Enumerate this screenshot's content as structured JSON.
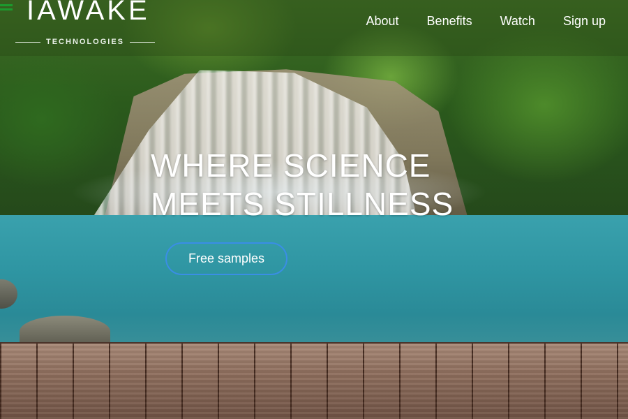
{
  "brand": {
    "name": "IAWAKE",
    "subtitle": "TECHNOLOGIES"
  },
  "nav": {
    "menu_icon": "hamburger-menu-icon",
    "links": [
      "About",
      "Benefits",
      "Watch",
      "Sign up"
    ]
  },
  "hero": {
    "title_lines": [
      "WHERE SCIENCE",
      "MEETS STILLNESS"
    ],
    "cta_label": "Free samples"
  },
  "colors": {
    "accent_menu": "#1c9a2e",
    "cta_border": "#3a8ee6",
    "text": "#ffffff"
  }
}
